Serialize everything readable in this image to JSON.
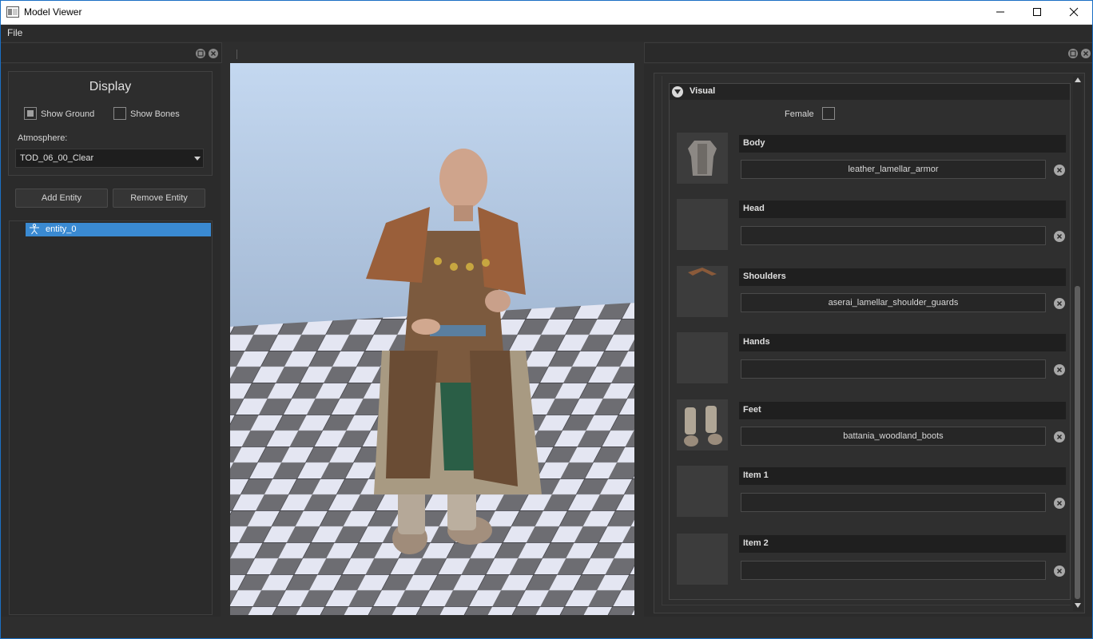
{
  "window": {
    "title": "Model Viewer"
  },
  "menu": {
    "file": "File"
  },
  "display": {
    "title": "Display",
    "show_ground": {
      "label": "Show Ground",
      "checked": true
    },
    "show_bones": {
      "label": "Show Bones",
      "checked": false
    },
    "atmosphere_label": "Atmosphere:",
    "atmosphere_value": "TOD_06_00_Clear"
  },
  "buttons": {
    "add_entity": "Add Entity",
    "remove_entity": "Remove Entity"
  },
  "entities": [
    {
      "label": "entity_0",
      "selected": true
    }
  ],
  "visual": {
    "title": "Visual",
    "female_label": "Female",
    "female_checked": false,
    "slots": [
      {
        "title": "Body",
        "value": "leather_lamellar_armor",
        "thumb": "armor"
      },
      {
        "title": "Head",
        "value": "",
        "thumb": ""
      },
      {
        "title": "Shoulders",
        "value": "aserai_lamellar_shoulder_guards",
        "thumb": "shoulders"
      },
      {
        "title": "Hands",
        "value": "",
        "thumb": ""
      },
      {
        "title": "Feet",
        "value": "battania_woodland_boots",
        "thumb": "boots"
      },
      {
        "title": "Item 1",
        "value": "",
        "thumb": ""
      },
      {
        "title": "Item 2",
        "value": "",
        "thumb": ""
      }
    ]
  },
  "colors": {
    "accent": "#3a8ad2",
    "sky_top": "#bcd3ee",
    "sky_bottom": "#9cb3d0",
    "tile_light": "#e4e6f2",
    "tile_dark": "#6e6e72"
  }
}
